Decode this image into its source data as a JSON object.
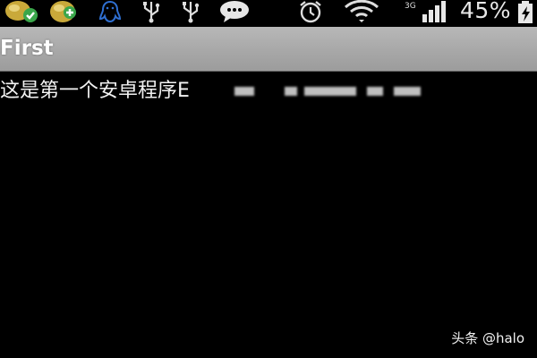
{
  "status_bar": {
    "icons": [
      "app-notification-icon",
      "app-notification-icon",
      "qq-icon",
      "usb-icon",
      "usb-icon",
      "chat-icon",
      "alarm-icon",
      "wifi-icon",
      "signal-icon",
      "battery-charging-icon"
    ],
    "battery_text": "45%"
  },
  "app": {
    "title": "First",
    "content_text": "这是第一个安卓程序E"
  },
  "watermark": {
    "text": "头条 @halo"
  },
  "colors": {
    "title_bar": "#a9a9a9",
    "background": "#000000",
    "text": "#ffffff"
  }
}
